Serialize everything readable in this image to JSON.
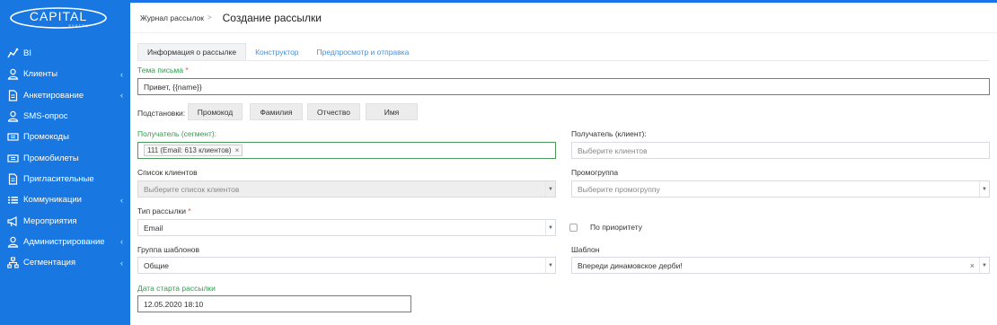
{
  "app": {
    "logo_text": "CAPITAL",
    "logo_sub": "SYSTEM"
  },
  "sidebar": {
    "items": [
      {
        "label": "BI",
        "icon": "chart-line-icon",
        "chevron": ""
      },
      {
        "label": "Клиенты",
        "icon": "user-icon",
        "chevron": "‹"
      },
      {
        "label": "Анкетирование",
        "icon": "document-icon",
        "chevron": "‹"
      },
      {
        "label": "SMS-опрос",
        "icon": "user-icon",
        "chevron": ""
      },
      {
        "label": "Промокоды",
        "icon": "ticket-icon",
        "chevron": ""
      },
      {
        "label": "Промобилеты",
        "icon": "ticket-icon",
        "chevron": ""
      },
      {
        "label": "Пригласительные",
        "icon": "document-icon",
        "chevron": ""
      },
      {
        "label": "Коммуникации",
        "icon": "list-icon",
        "chevron": "‹"
      },
      {
        "label": "Мероприятия",
        "icon": "megaphone-icon",
        "chevron": ""
      },
      {
        "label": "Администрирование",
        "icon": "user-icon",
        "chevron": "‹"
      },
      {
        "label": "Сегментация",
        "icon": "sitemap-icon",
        "chevron": "‹"
      }
    ]
  },
  "header": {
    "breadcrumb": "Журнал рассылок",
    "separator": ">",
    "title": "Создание рассылки"
  },
  "tabs": [
    {
      "label": "Информация о рассылке",
      "active": true
    },
    {
      "label": "Конструктор",
      "active": false
    },
    {
      "label": "Предпросмотр и отправка",
      "active": false
    }
  ],
  "form": {
    "subject_label": "Тема письма",
    "subject_value": "Привет, {{name}}",
    "substitutions_label": "Подстановки:",
    "substitutions": [
      "Промокод",
      "Фамилия",
      "Отчество",
      "Имя"
    ],
    "recipient_segment_label": "Получатель (сегмент):",
    "recipient_segment_chip": "111 (Email: 613 клиентов)",
    "chip_remove": "×",
    "recipient_client_label": "Получатель (клиент):",
    "recipient_client_placeholder": "Выберите клиентов",
    "client_list_label": "Список клиентов",
    "client_list_placeholder": "Выберите список клиентов",
    "promo_group_label": "Промогруппа",
    "promo_group_placeholder": "Выберите промогруппу",
    "mailing_type_label": "Тип рассылки",
    "mailing_type_value": "Email",
    "priority_label": "По приоритету",
    "template_group_label": "Группа шаблонов",
    "template_group_value": "Общие",
    "template_label": "Шаблон",
    "template_value": "Впереди динамовское дерби!",
    "template_clear": "×",
    "start_date_label": "Дата старта рассылки",
    "start_date_value": "12.05.2020 18:10",
    "required_mark": "*",
    "dropdown_arrow": "▼"
  },
  "colors": {
    "sidebar_bg": "#1877e0",
    "accent_green": "#2e9e4f",
    "link_blue": "#4a90d9"
  }
}
